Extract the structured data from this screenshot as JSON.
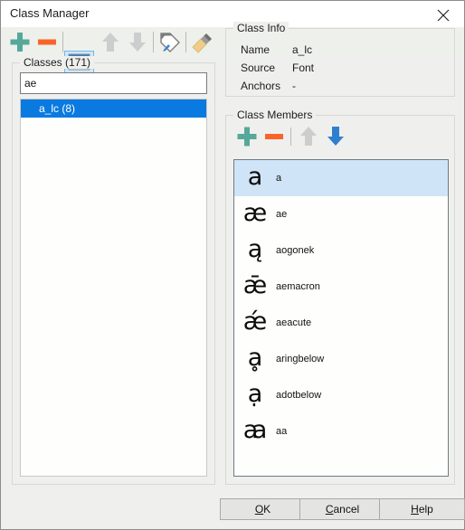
{
  "window": {
    "title": "Class Manager",
    "close_icon": "close-icon"
  },
  "toolbar": {
    "buttons": [
      {
        "name": "add-class-button",
        "icon": "plus-icon",
        "enabled": true
      },
      {
        "name": "remove-class-button",
        "icon": "minus-icon",
        "enabled": true
      },
      {
        "name": "sort-toggle-button",
        "icon": "sort-updown-icon",
        "enabled": true,
        "active": true
      },
      {
        "name": "move-up-button",
        "icon": "arrow-up-icon",
        "enabled": false
      },
      {
        "name": "move-down-button",
        "icon": "arrow-down-icon",
        "enabled": false
      },
      {
        "name": "rename-tag-button",
        "icon": "tag-pen-icon",
        "enabled": true
      },
      {
        "name": "clean-button",
        "icon": "brush-icon",
        "enabled": true
      }
    ]
  },
  "classes": {
    "group_label": "Classes (171)",
    "count": 171,
    "search": {
      "value": "ae",
      "placeholder": ""
    },
    "items": [
      {
        "label": "a_lc (8)",
        "selected": true
      }
    ]
  },
  "class_info": {
    "group_label": "Class Info",
    "rows": [
      {
        "key": "Name",
        "value": "a_lc"
      },
      {
        "key": "Source",
        "value": "Font"
      },
      {
        "key": "Anchors",
        "value": "-"
      }
    ]
  },
  "class_members": {
    "group_label": "Class Members",
    "toolbar": [
      {
        "name": "add-member-button",
        "icon": "plus-icon",
        "enabled": true
      },
      {
        "name": "remove-member-button",
        "icon": "minus-icon",
        "enabled": true
      },
      {
        "name": "member-up-button",
        "icon": "arrow-up-icon",
        "enabled": false
      },
      {
        "name": "member-down-button",
        "icon": "arrow-down-icon",
        "enabled": true
      }
    ],
    "items": [
      {
        "glyph": "a",
        "name": "a",
        "selected": true
      },
      {
        "glyph": "æ",
        "name": "ae",
        "selected": false
      },
      {
        "glyph": "ą",
        "name": "aogonek",
        "selected": false
      },
      {
        "glyph": "ǣ",
        "name": "aemacron",
        "selected": false
      },
      {
        "glyph": "ǽ",
        "name": "aeacute",
        "selected": false
      },
      {
        "glyph": "ḁ",
        "name": "aringbelow",
        "selected": false
      },
      {
        "glyph": "ạ",
        "name": "adotbelow",
        "selected": false
      },
      {
        "glyph": "ꜳ",
        "name": "aa",
        "selected": false
      }
    ]
  },
  "footer": {
    "buttons": [
      {
        "name": "ok-button",
        "accel": "O",
        "rest": "K"
      },
      {
        "name": "cancel-button",
        "accel": "C",
        "rest": "ancel"
      },
      {
        "name": "help-button",
        "accel": "H",
        "rest": "elp"
      }
    ]
  },
  "colors": {
    "accent_green": "#56a89a",
    "accent_orange": "#f96528",
    "accent_blue": "#2f7fd0",
    "selection_blue": "#0a7ae0",
    "row_selection": "#cfe4f7",
    "disabled_gray": "#cdcdcd"
  }
}
